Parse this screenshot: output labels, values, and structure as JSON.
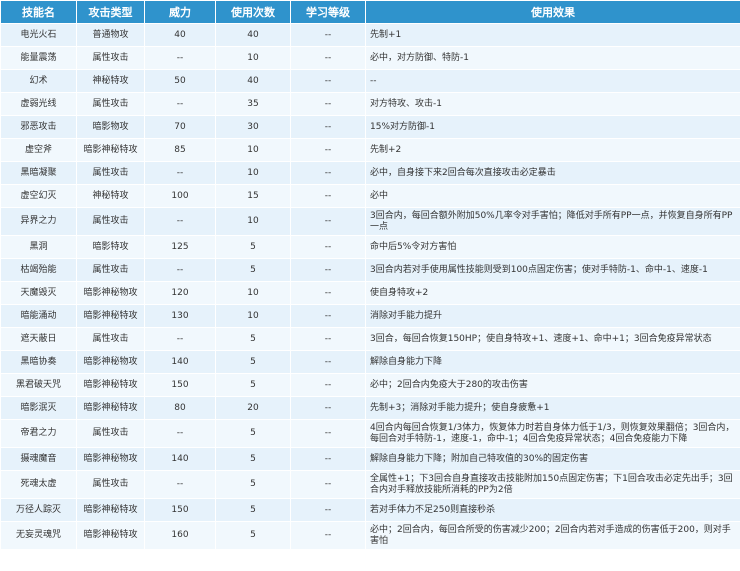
{
  "table": {
    "headers": [
      "技能名",
      "攻击类型",
      "威力",
      "使用次数",
      "学习等级",
      "使用效果"
    ],
    "rows": [
      [
        "电光火石",
        "普通物攻",
        "40",
        "40",
        "--",
        "先制+1"
      ],
      [
        "能量震荡",
        "属性攻击",
        "--",
        "10",
        "--",
        "必中，对方防御、特防-1"
      ],
      [
        "幻术",
        "神秘特攻",
        "50",
        "40",
        "--",
        "--"
      ],
      [
        "虚弱光线",
        "属性攻击",
        "--",
        "35",
        "--",
        "对方特攻、攻击-1"
      ],
      [
        "邪恶攻击",
        "暗影物攻",
        "70",
        "30",
        "--",
        "15%对方防御-1"
      ],
      [
        "虚空斧",
        "暗影神秘特攻",
        "85",
        "10",
        "--",
        "先制+2"
      ],
      [
        "黑暗凝聚",
        "属性攻击",
        "--",
        "10",
        "--",
        "必中，自身接下来2回合每次直接攻击必定暴击"
      ],
      [
        "虚空幻灭",
        "神秘特攻",
        "100",
        "15",
        "--",
        "必中"
      ],
      [
        "异界之力",
        "属性攻击",
        "--",
        "10",
        "--",
        "3回合内，每回合额外附加50%几率令对手害怕；降低对手所有PP一点，并恢复自身所有PP一点"
      ],
      [
        "黑洞",
        "暗影特攻",
        "125",
        "5",
        "--",
        "命中后5%令对方害怕"
      ],
      [
        "枯竭殆能",
        "属性攻击",
        "--",
        "5",
        "--",
        "3回合内若对手使用属性技能则受到100点固定伤害；使对手特防-1、命中-1、速度-1"
      ],
      [
        "天魔毁灭",
        "暗影神秘物攻",
        "120",
        "10",
        "--",
        "使自身特攻+2"
      ],
      [
        "暗能涌动",
        "暗影神秘特攻",
        "130",
        "10",
        "--",
        "消除对手能力提升"
      ],
      [
        "遮天蔽日",
        "属性攻击",
        "--",
        "5",
        "--",
        "3回合，每回合恢复150HP；使自身特攻+1、速度+1、命中+1；3回合免疫异常状态"
      ],
      [
        "黑暗协奏",
        "暗影神秘物攻",
        "140",
        "5",
        "--",
        "解除自身能力下降"
      ],
      [
        "黑君破天咒",
        "暗影神秘特攻",
        "150",
        "5",
        "--",
        "必中；2回合内免疫大于280的攻击伤害"
      ],
      [
        "暗影泯灭",
        "暗影神秘特攻",
        "80",
        "20",
        "--",
        "先制+3；消除对手能力提升；使自身疲惫+1"
      ],
      [
        "帝君之力",
        "属性攻击",
        "--",
        "5",
        "--",
        "4回合内每回合恢复1/3体力，恢复体力时若自身体力低于1/3，则恢复效果翻倍；3回合内，每回合对手特防-1，速度-1，命中-1；4回合免疫异常状态；4回合免疫能力下降"
      ],
      [
        "摄魂魔音",
        "暗影神秘物攻",
        "140",
        "5",
        "--",
        "解除自身能力下降；附加自己特攻值的30%的固定伤害"
      ],
      [
        "死魂太虚",
        "属性攻击",
        "--",
        "5",
        "--",
        "全属性+1；下3回合自身直接攻击技能附加150点固定伤害；下1回合攻击必定先出手；3回合内对手释放技能所消耗的PP为2倍"
      ],
      [
        "万径人踪灭",
        "暗影神秘特攻",
        "150",
        "5",
        "--",
        "若对手体力不足250则直接秒杀"
      ],
      [
        "无妄灵魂咒",
        "暗影神秘特攻",
        "160",
        "5",
        "--",
        "必中；2回合内，每回合所受的伤害减少200；2回合内若对手造成的伤害低于200，则对手害怕"
      ]
    ]
  }
}
